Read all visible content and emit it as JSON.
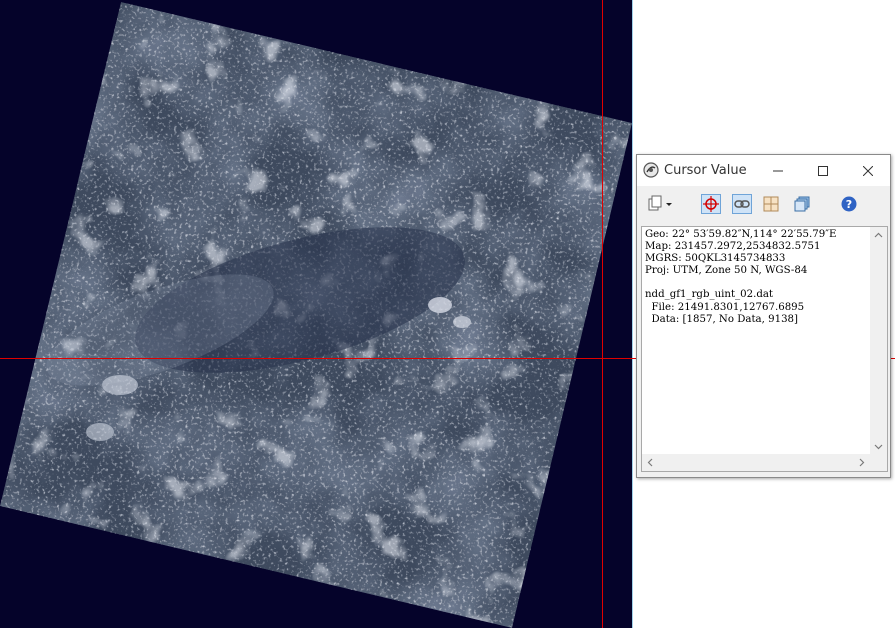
{
  "window": {
    "title": "Cursor Value",
    "icon": "cursor-value-app-icon",
    "controls": [
      "minimize-icon",
      "maximize-icon",
      "close-icon"
    ]
  },
  "toolbar": {
    "items": [
      "export-menu-icon",
      "crosshair-icon",
      "link-icon",
      "grid-icon",
      "layers-icon",
      "help-icon"
    ]
  },
  "readout": {
    "geo": "Geo: 22° 53′59.82″N,114° 22′55.79″E",
    "map": "Map: 231457.2972,2534832.5751",
    "mgrs": "MGRS: 50QKL3145734833",
    "proj": "Proj: UTM, Zone 50 N, WGS-84",
    "blank": "",
    "file_name": "ndd_gf1_rgb_uint_02.dat",
    "file_coords": "  File: 21491.8301,12767.6895",
    "data_values": "  Data: [1857, No Data, 9138]"
  },
  "colors": {
    "viewer_background": "#05032a",
    "crosshair": "#e00000",
    "toolbar_active": "#cfe3f7"
  }
}
